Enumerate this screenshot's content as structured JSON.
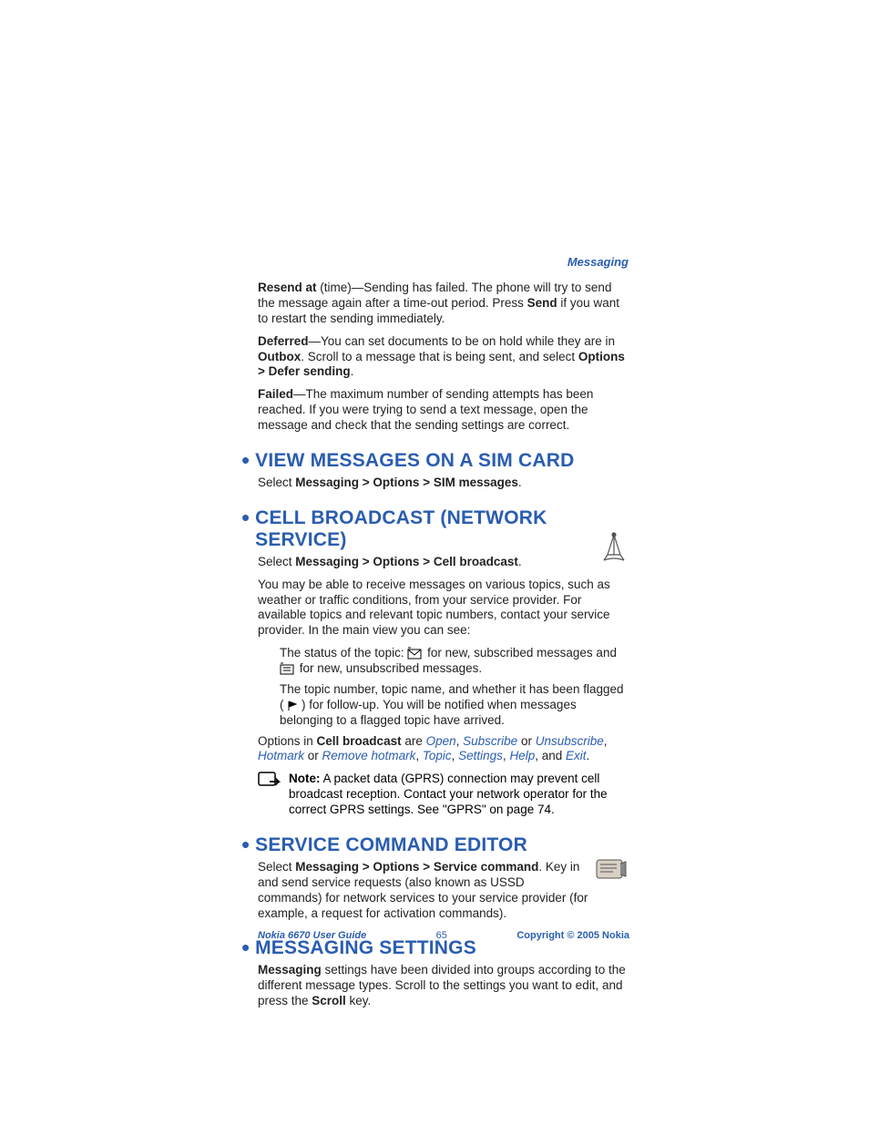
{
  "header": {
    "section": "Messaging"
  },
  "para_resend": {
    "bold1": "Resend at",
    "t1": " (time)—Sending has failed. The phone will try to send the message again after a time-out period. Press ",
    "bold2": "Send",
    "t2": " if you want to restart the sending immediately."
  },
  "para_deferred": {
    "bold1": "Deferred",
    "t1": "—You can set documents to be on hold while they are in ",
    "bold2": "Outbox",
    "t2": ". Scroll to a message that is being sent, and select ",
    "bold3": "Options > Defer sending",
    "t3": "."
  },
  "para_failed": {
    "bold1": "Failed",
    "t1": "—The maximum number of sending attempts has been reached. If you were trying to send a text message, open the message and check that the sending settings are correct."
  },
  "sec_sim": {
    "title": "VIEW MESSAGES ON A SIM CARD",
    "t1": "Select ",
    "bold1": "Messaging > Options > SIM messages",
    "t2": "."
  },
  "sec_cb": {
    "title": "CELL BROADCAST (NETWORK SERVICE)",
    "t1": "Select ",
    "bold1": "Messaging > Options > Cell broadcast",
    "t2": ".",
    "p2": "You may be able to receive messages on various topics, such as weather or traffic conditions, from your service provider. For available topics and relevant topic numbers, contact your service provider. In the main view you can see:",
    "li1a": "The status of the topic: ",
    "li1b": " for new, subscribed messages and ",
    "li1c": " for new, unsubscribed messages.",
    "li2a": "The topic number, topic name, and whether it has been flagged (",
    "li2b": ") for follow-up. You will be notified when messages belonging to a flagged topic have arrived.",
    "opts_pre": "Options in ",
    "opts_bold": "Cell broadcast",
    "opts_mid": " are ",
    "opt1": "Open",
    "opt2": "Subscribe",
    "opt3": "Unsubscribe",
    "opt4": "Hotmark",
    "opt5": "Remove hotmark",
    "opt6": "Topic",
    "opt7": "Settings",
    "opt8": "Help",
    "opt9": "Exit",
    "note_bold": "Note:",
    "note_text": " A packet data (GPRS) connection may prevent cell broadcast reception. Contact your network operator for the correct GPRS settings. See \"GPRS\" on page 74."
  },
  "sec_sc": {
    "title": "SERVICE COMMAND EDITOR",
    "t1": "Select ",
    "bold1": "Messaging > Options > Service command",
    "t2": ". Key in and send service requests (also known as USSD commands) for network services to your service provider (for example, a request for activation commands)."
  },
  "sec_ms": {
    "title": "MESSAGING SETTINGS",
    "bold1": "Messaging",
    "t1": " settings have been divided into groups according to the different message types. Scroll to the settings you want to edit, and press the ",
    "bold2": "Scroll",
    "t2": " key."
  },
  "footer": {
    "left": "Nokia 6670 User Guide",
    "center": "65",
    "right": "Copyright © 2005 Nokia"
  }
}
